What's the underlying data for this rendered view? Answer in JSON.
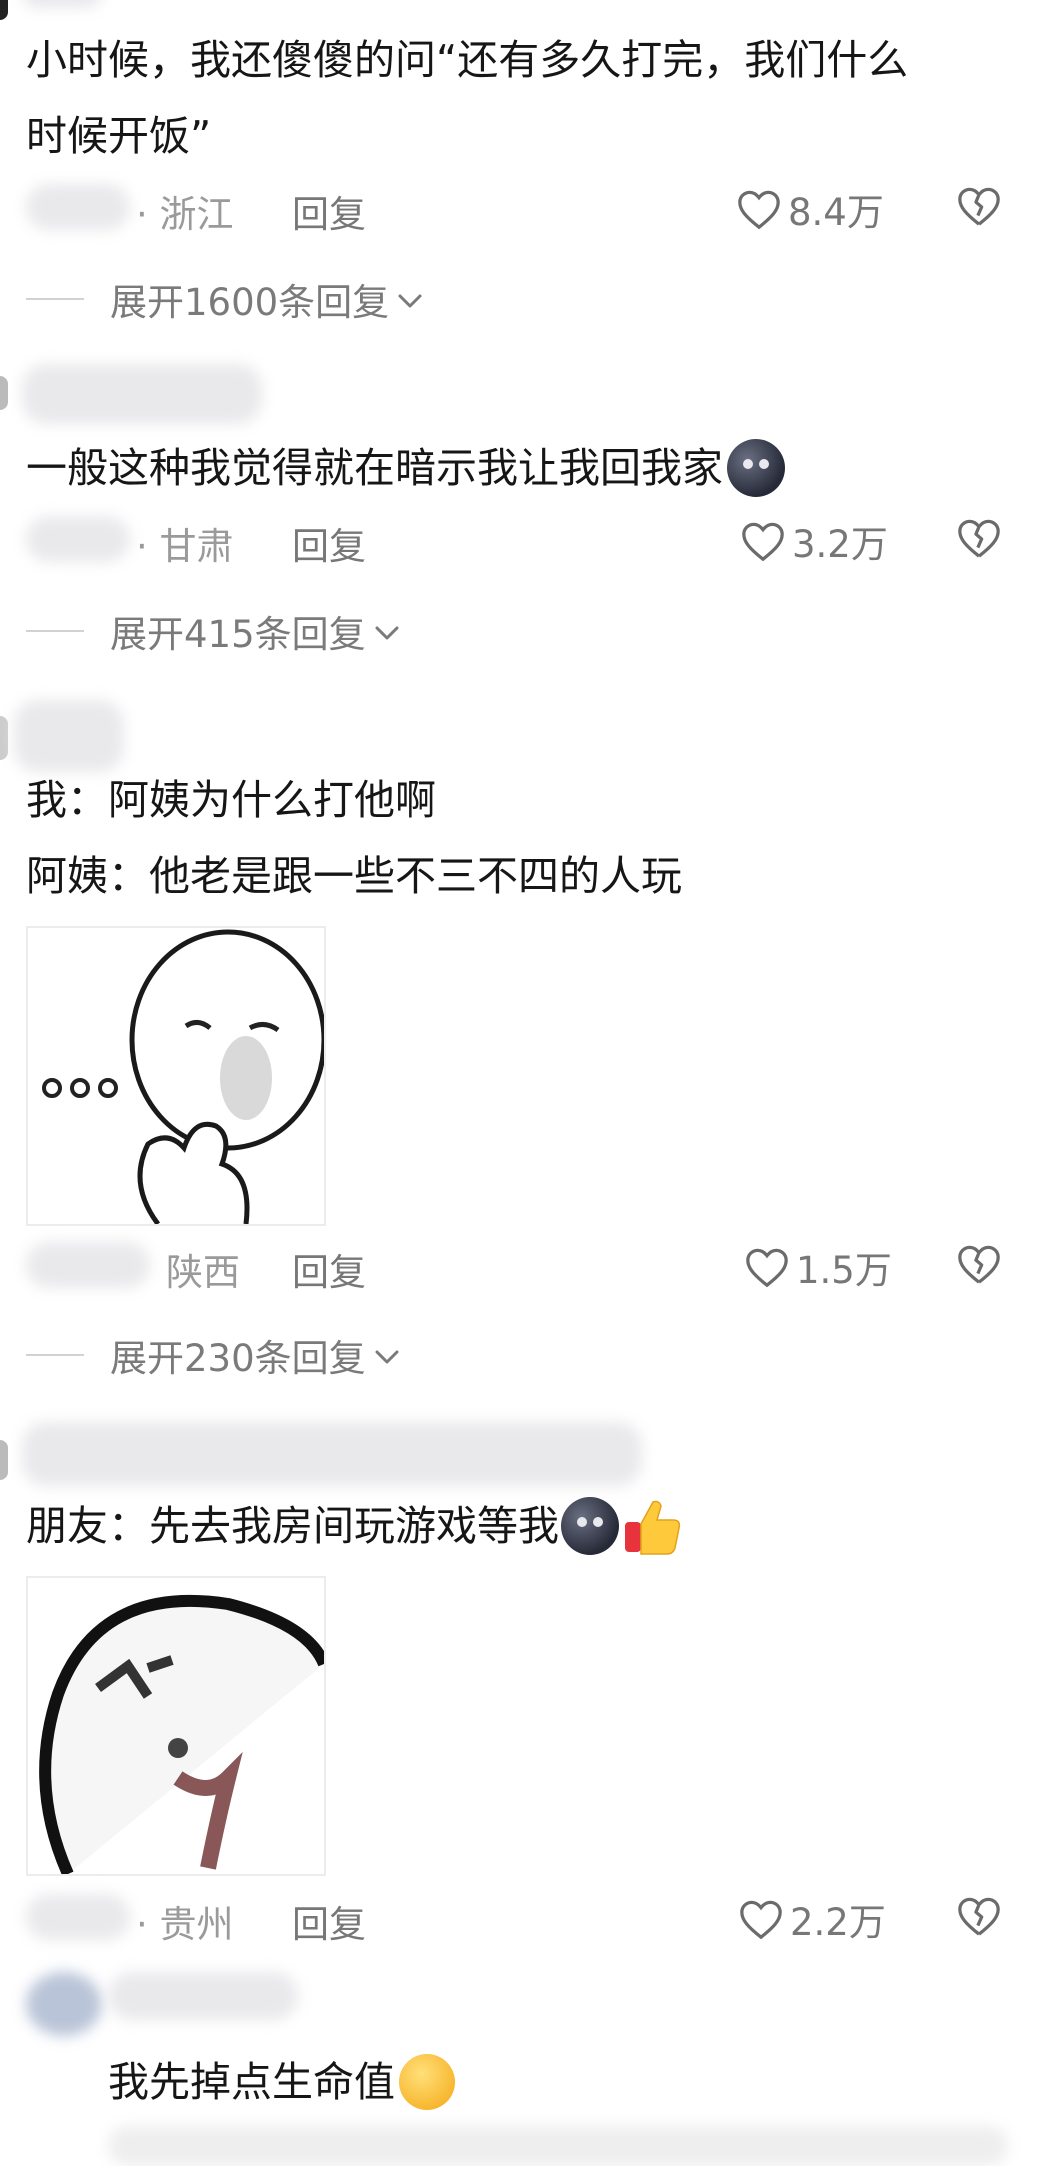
{
  "comments": [
    {
      "text_lines": [
        "小时候，我还傻傻的问“还有多久打完，我们什么",
        "时候开饭”"
      ],
      "region": "浙江",
      "reply_label": "回复",
      "likes": "8.4万",
      "expand_label": "展开1600条回复"
    },
    {
      "text_lines": [
        "一般这种我觉得就在暗示我让我回我家"
      ],
      "emoji": "new-moon-face",
      "region": "甘肃",
      "reply_label": "回复",
      "likes": "3.2万",
      "expand_label": "展开415条回复"
    },
    {
      "text_lines": [
        "我：阿姨为什么打他啊",
        "阿姨：他老是跟一些不三不四的人玩"
      ],
      "sticker": "thinking-meme-face",
      "region": "陕西",
      "reply_label": "回复",
      "likes": "1.5万",
      "expand_label": "展开230条回复"
    },
    {
      "text_lines": [
        "朋友：先去我房间玩游戏等我"
      ],
      "emoji": [
        "new-moon-face",
        "thumbs-up"
      ],
      "sticker": "blurry-meme-face",
      "region": "贵州",
      "reply_label": "回复",
      "likes": "2.2万"
    },
    {
      "text_lines": [
        "我先掉点生命值"
      ],
      "emoji": "pleading-face"
    }
  ],
  "colors": {
    "text": "#161616",
    "meta": "#9a9a9a",
    "muted": "#777777",
    "background": "#ffffff"
  }
}
